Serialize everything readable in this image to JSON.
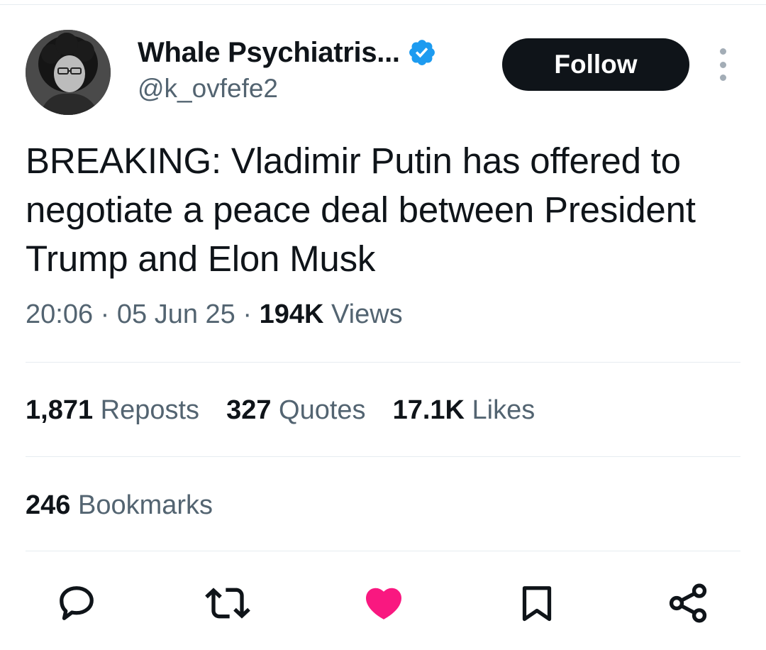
{
  "author": {
    "display_name": "Whale Psychiatris...",
    "handle": "@k_ovfefe2",
    "verified": true
  },
  "follow_label": "Follow",
  "tweet": {
    "text": "BREAKING: Vladimir Putin has offered to negotiate a peace deal between President Trump and Elon Musk",
    "time": "20:06",
    "separator": " · ",
    "date": "05 Jun 25",
    "views_count": "194K",
    "views_label": "Views"
  },
  "stats": {
    "reposts": {
      "count": "1,871",
      "label": "Reposts"
    },
    "quotes": {
      "count": "327",
      "label": "Quotes"
    },
    "likes": {
      "count": "17.1K",
      "label": "Likes"
    },
    "bookmarks": {
      "count": "246",
      "label": "Bookmarks"
    }
  },
  "actions": [
    "reply-icon",
    "repost-icon",
    "like-icon",
    "bookmark-icon",
    "share-icon"
  ],
  "colors": {
    "text_primary": "#0f1419",
    "text_secondary": "#536471",
    "verified_blue": "#1d9bf0",
    "like_pink": "#f91880",
    "follow_bg": "#0f1419",
    "divider": "#e6ecf0"
  }
}
